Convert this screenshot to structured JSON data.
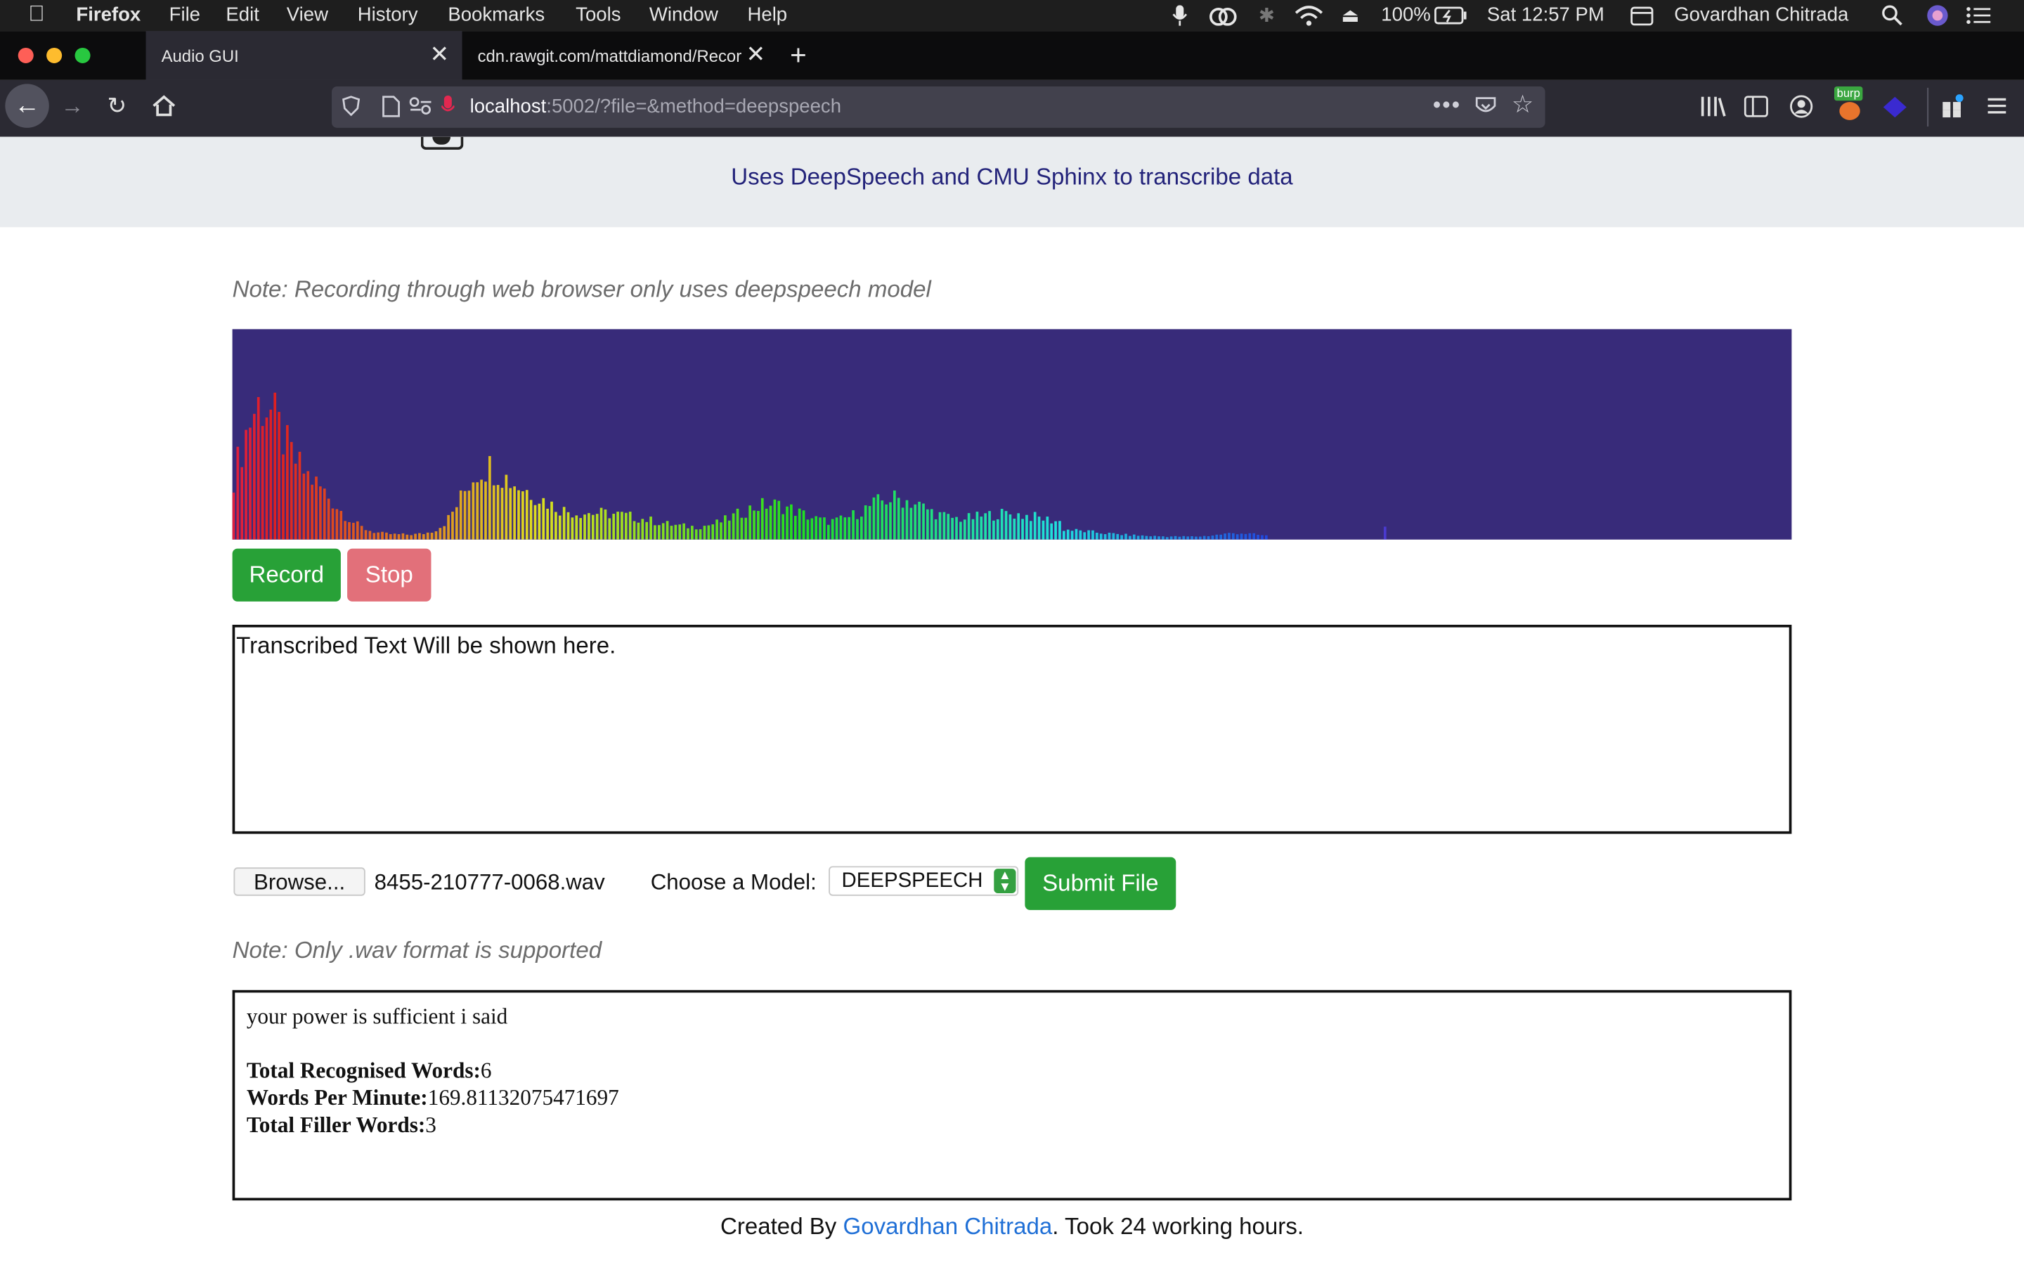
{
  "menubar": {
    "app": "Firefox",
    "items": [
      "File",
      "Edit",
      "View",
      "History",
      "Bookmarks",
      "Tools",
      "Window",
      "Help"
    ],
    "battery": "100%",
    "clock": "Sat 12:57 PM",
    "user": "Govardhan Chitrada"
  },
  "tabs": [
    {
      "title": "Audio GUI",
      "active": true
    },
    {
      "title": "cdn.rawgit.com/mattdiamond/Recor",
      "active": false
    }
  ],
  "nav": {
    "url_host": "localhost",
    "url_rest": ":5002/?file=&method=deepspeech",
    "burp_badge": "burp"
  },
  "page": {
    "subtitle": "Uses DeepSpeech and CMU Sphinx to transcribe data",
    "note_recording": "Note: Recording through web browser only uses deepspeech model",
    "record_label": "Record",
    "stop_label": "Stop",
    "transcript_placeholder": "Transcribed Text Will be shown here.",
    "browse_label": "Browse...",
    "filename": "8455-210777-0068.wav",
    "model_label": "Choose a Model:",
    "model_selected": "DEEPSPEECH",
    "submit_label": "Submit File",
    "note_format": "Note: Only .wav format is supported",
    "result_text": "your power is sufficient i said",
    "stats": {
      "total_words_label": "Total Recognised Words:",
      "total_words": "6",
      "wpm_label": "Words Per Minute:",
      "wpm": "169.81132075471697",
      "filler_label": "Total Filler Words:",
      "filler": "3"
    },
    "footer_prefix": "Created By ",
    "footer_link": "Govardhan Chitrada",
    "footer_suffix": ". Took 24 working hours."
  },
  "colors": {
    "visualizer_bg": "#382b7a",
    "record": "#28a137",
    "stop": "#e2707a",
    "link": "#1f6fd6"
  }
}
